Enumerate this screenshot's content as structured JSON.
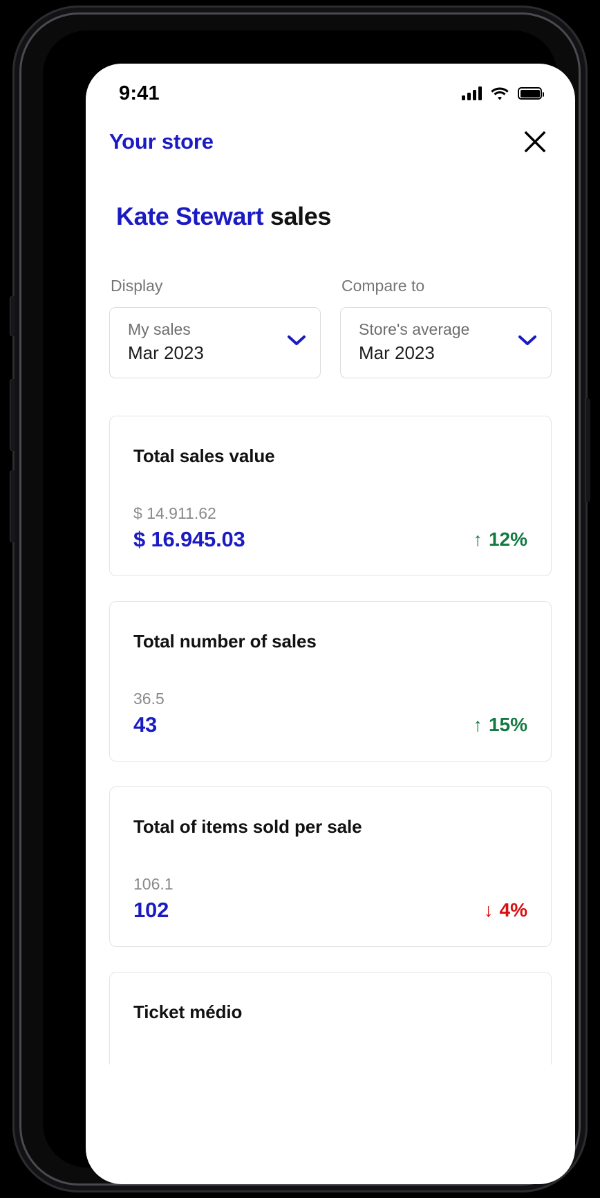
{
  "device": {
    "status_bar": {
      "time": "9:41",
      "cellular_icon": "cellular-bars-icon",
      "wifi_icon": "wifi-icon",
      "battery_icon": "battery-full-icon",
      "battery_level_pct": 100
    }
  },
  "colors": {
    "brand_blue": "#1b1bc4",
    "positive_green": "#147a42",
    "negative_red": "#d81010",
    "muted_gray": "#8a8a8a",
    "border": "#e4e4e4"
  },
  "topbar": {
    "store_link_label": "Your store",
    "close_icon": "close-icon"
  },
  "title": {
    "person_name": "Kate Stewart",
    "suffix": " sales"
  },
  "selectors": [
    {
      "label": "Display",
      "value_primary": "My sales",
      "value_secondary": "Mar 2023",
      "chevron_icon": "chevron-down-icon"
    },
    {
      "label": "Compare to",
      "value_primary": "Store's average",
      "value_secondary": "Mar 2023",
      "chevron_icon": "chevron-down-icon"
    }
  ],
  "cards": [
    {
      "title": "Total sales value",
      "compare_value": "$ 14.911.62",
      "main_value": "$ 16.945.03",
      "delta_arrow": "↑",
      "delta_label": "12%",
      "delta_direction": "up"
    },
    {
      "title": "Total number of sales",
      "compare_value": "36.5",
      "main_value": "43",
      "delta_arrow": "↑",
      "delta_label": "15%",
      "delta_direction": "up"
    },
    {
      "title": "Total of items sold per sale",
      "compare_value": "106.1",
      "main_value": "102",
      "delta_arrow": "↓",
      "delta_label": "4%",
      "delta_direction": "down"
    }
  ],
  "partial_card": {
    "title": "Ticket médio"
  }
}
